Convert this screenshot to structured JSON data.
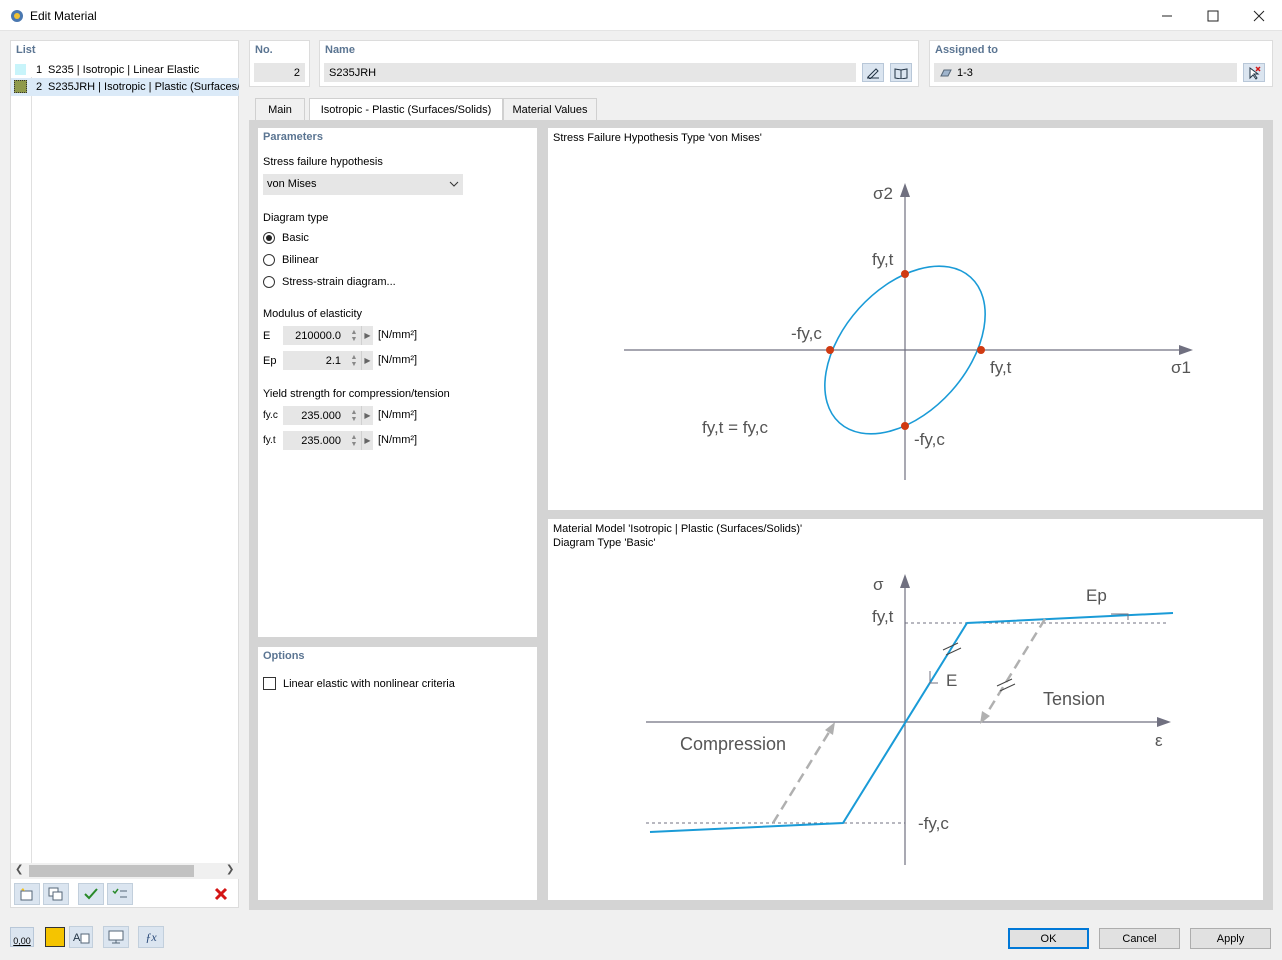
{
  "window": {
    "title": "Edit Material"
  },
  "list": {
    "header": "List",
    "items": [
      {
        "no": "1",
        "label": "S235 | Isotropic | Linear Elastic",
        "color": "#c8f4fa"
      },
      {
        "no": "2",
        "label": "S235JRH | Isotropic | Plastic (Surfaces/",
        "color": "#8f9a4c"
      }
    ]
  },
  "fields": {
    "no_label": "No.",
    "no_value": "2",
    "name_label": "Name",
    "name_value": "S235JRH",
    "assigned_label": "Assigned to",
    "assigned_value": "1-3"
  },
  "tabs": [
    "Main",
    "Isotropic - Plastic (Surfaces/Solids)",
    "Material Values"
  ],
  "parameters": {
    "header": "Parameters",
    "failure_label": "Stress failure hypothesis",
    "failure_value": "von Mises",
    "diagram_label": "Diagram type",
    "diagram_options": [
      "Basic",
      "Bilinear",
      "Stress-strain diagram..."
    ],
    "diagram_selected": "Basic",
    "modulus_label": "Modulus of elasticity",
    "E_label": "E",
    "E_value": "210000.0",
    "Ep_label": "Ep",
    "Ep_value": "2.1",
    "unit": "[N/mm²]",
    "yield_label": "Yield strength for compression/tension",
    "fyc_label": "fy.c",
    "fyc_value": "235.000",
    "fyt_label": "fy.t",
    "fyt_value": "235.000"
  },
  "options": {
    "header": "Options",
    "checkbox_label": "Linear elastic with nonlinear criteria",
    "checked": false
  },
  "diagram1": {
    "title": "Stress Failure Hypothesis Type 'von Mises'",
    "sigma2": "σ2",
    "sigma1": "σ1",
    "fyt_top": "fy,t",
    "fyt_right": "fy,t",
    "fyc_left": "-fy,c",
    "fyc_bottom": "-fy,c",
    "equation": "fy,t = fy,c"
  },
  "diagram2": {
    "title_line1": "Material Model 'Isotropic | Plastic (Surfaces/Solids)'",
    "title_line2": "Diagram Type 'Basic'",
    "sigma": "σ",
    "epsilon": "ε",
    "fyt": "fy,t",
    "fyc": "-fy,c",
    "E": "E",
    "Ep": "Ep",
    "tension": "Tension",
    "compression": "Compression"
  },
  "buttons": {
    "ok": "OK",
    "cancel": "Cancel",
    "apply": "Apply"
  },
  "status_icons": {
    "units": "0,00",
    "color": "#f5c400"
  },
  "colors": {
    "accent": "#1a9bd7",
    "point": "#d03a12",
    "header": "#5b7592"
  }
}
